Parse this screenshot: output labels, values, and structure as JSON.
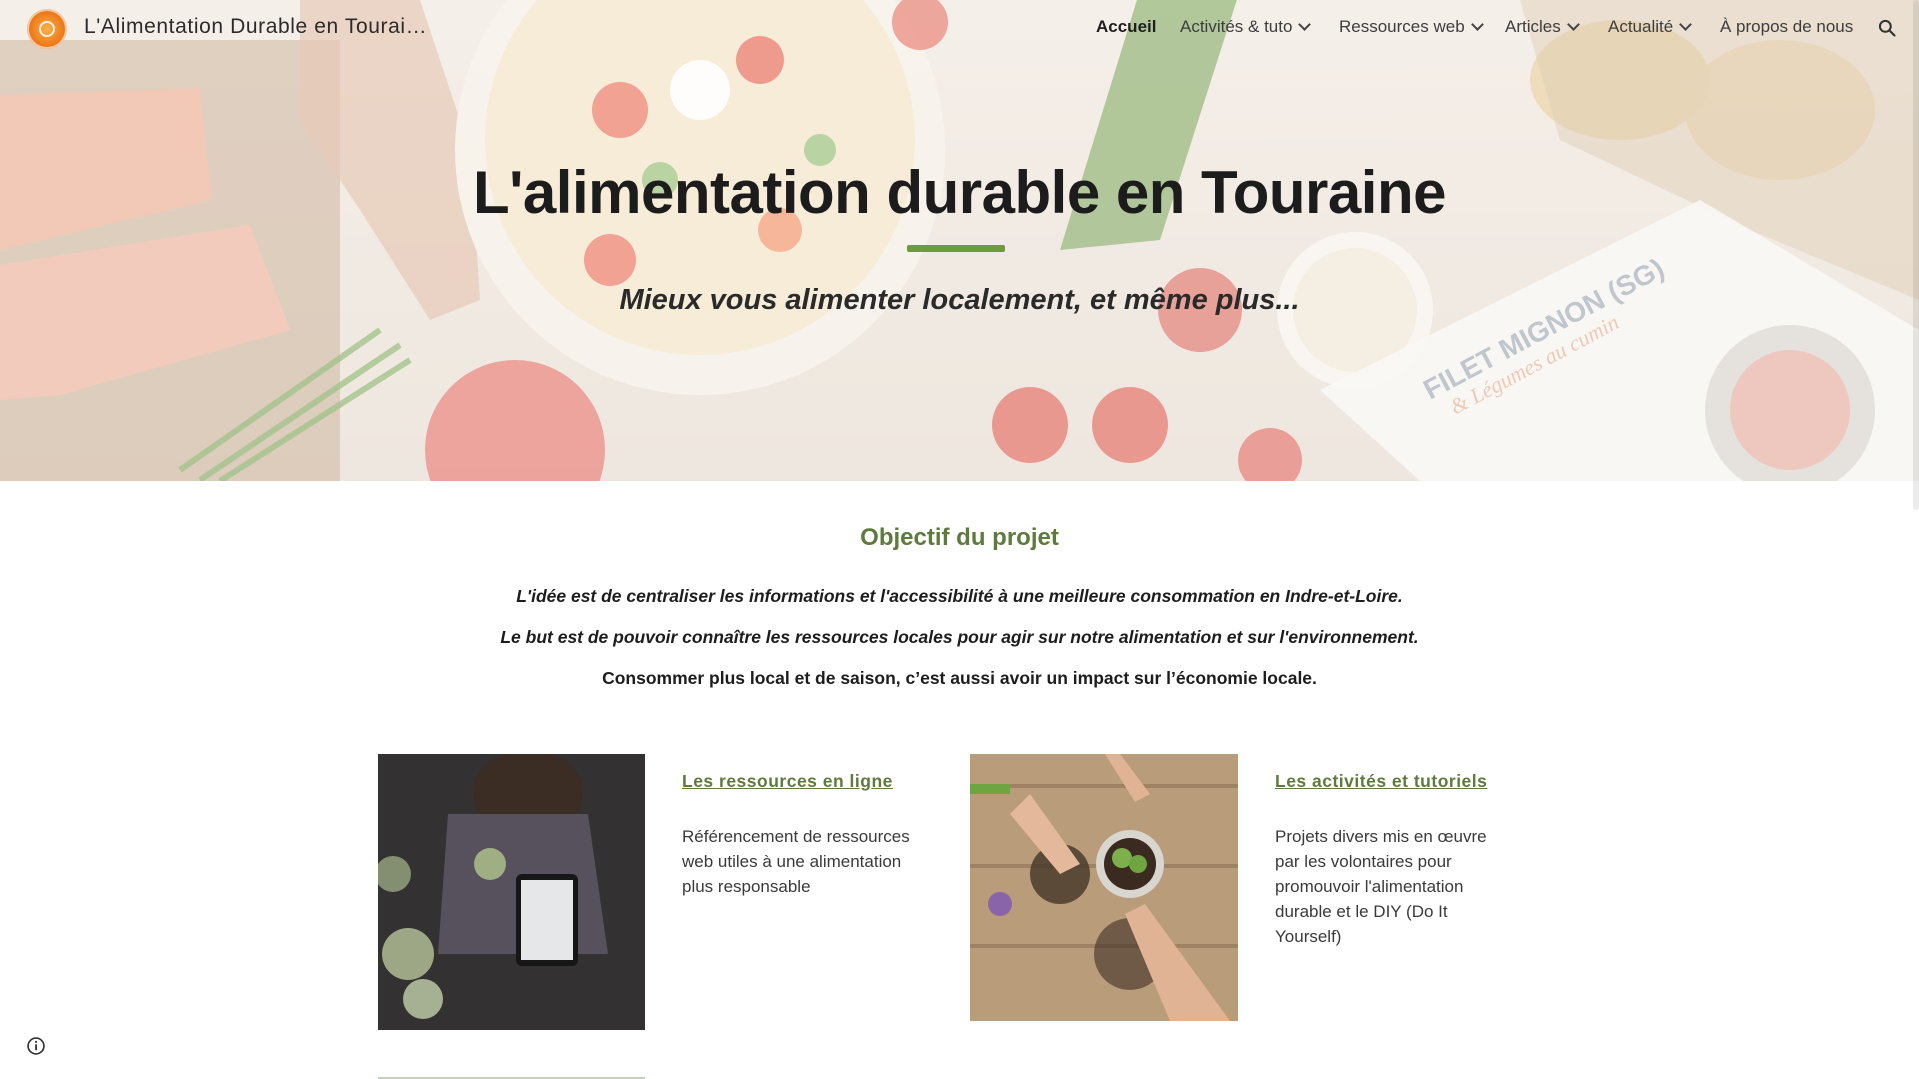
{
  "header": {
    "site_title": "L'Alimentation Durable en Tourai…",
    "nav": [
      {
        "label": "Accueil"
      },
      {
        "label": "Activités & tuto"
      },
      {
        "label": "Ressources web"
      },
      {
        "label": "Articles"
      },
      {
        "label": "Actualité"
      },
      {
        "label": "À propos de nous"
      }
    ],
    "icons": {
      "logo": "site-logo",
      "search": "search-icon"
    }
  },
  "hero": {
    "title": "L'alimentation durable en Touraine",
    "subtitle": "Mieux vous alimenter localement, et même plus...",
    "card_text": {
      "line1": "FILET MIGNON (SG)",
      "line2": "& Légumes au cumin"
    }
  },
  "main": {
    "section_title": "Objectif du projet",
    "paragraphs": [
      "L'idée est de centraliser les informations et l'accessibilité à une meilleure consommation en Indre-et-Loire.",
      "Le but est de pouvoir connaître les ressources locales pour agir sur notre alimentation et sur l'environnement.",
      "Consommer plus local et de saison, c’est aussi avoir un impact sur l’économie locale."
    ],
    "cards": [
      {
        "title": "Les ressources en ligne",
        "description": "Référencement de ressources web utiles à une alimentation plus responsable"
      },
      {
        "title": "Les activités et tutoriels",
        "description": "Projets divers mis en œuvre par les volontaires pour promouvoir l'alimentation durable et le DIY (Do It Yourself)"
      }
    ]
  },
  "colors": {
    "accent_green": "#5e7a3c",
    "rule_green": "#6e9b3c",
    "logo_orange": "#ef7d1d"
  }
}
